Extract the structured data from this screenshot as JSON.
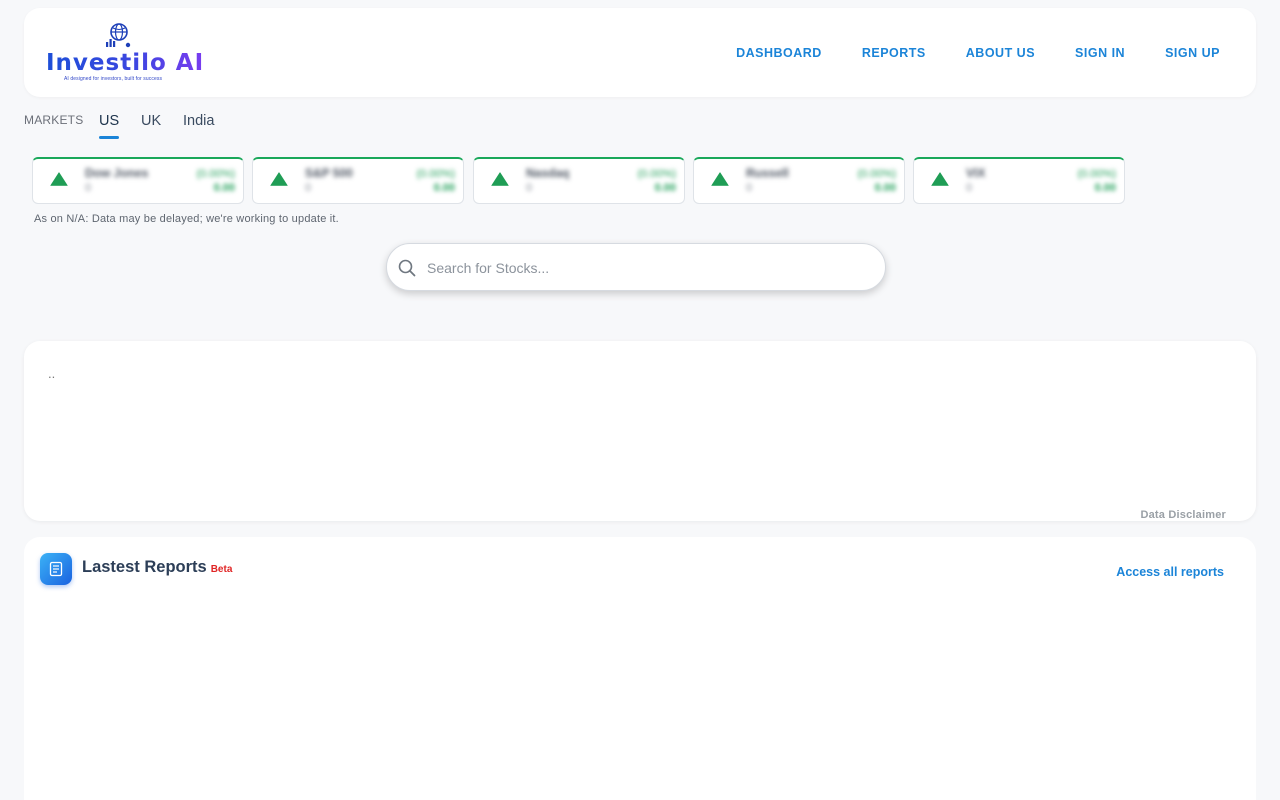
{
  "header": {
    "logo_text": "Investilo AI",
    "logo_tagline": "AI designed for investors, built for success",
    "nav": [
      "DASHBOARD",
      "REPORTS",
      "ABOUT US",
      "SIGN IN",
      "SIGN UP"
    ]
  },
  "markets": {
    "label": "MARKETS",
    "tabs": [
      "US",
      "UK",
      "India"
    ],
    "active_tab": "US"
  },
  "indices": [
    {
      "name": "Dow Jones",
      "price": "0",
      "pct": "(0.00%)",
      "change": "0.00"
    },
    {
      "name": "S&P 500",
      "price": "0",
      "pct": "(0.00%)",
      "change": "0.00"
    },
    {
      "name": "Nasdaq",
      "price": "0",
      "pct": "(0.00%)",
      "change": "0.00"
    },
    {
      "name": "Russell",
      "price": "0",
      "pct": "(0.00%)",
      "change": "0.00"
    },
    {
      "name": "VIX",
      "price": "0",
      "pct": "(0.00%)",
      "change": "0.00"
    }
  ],
  "delay_note": "As on N/A: Data may be delayed; we're working to update it.",
  "search": {
    "placeholder": "Search for Stocks..."
  },
  "info_panel": {
    "text": "..",
    "disclaimer": "Data Disclaimer"
  },
  "reports": {
    "title": "Lastest Reports",
    "badge": "Beta",
    "access_link": "Access all reports"
  },
  "colors": {
    "accent": "#1b84d8",
    "up": "#1f9d55",
    "beta": "#e02424"
  }
}
